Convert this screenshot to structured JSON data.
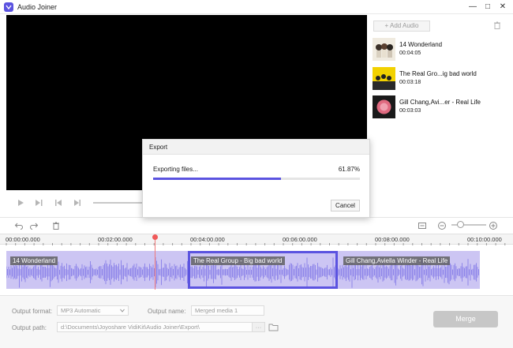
{
  "window": {
    "title": "Audio Joiner"
  },
  "sidebar": {
    "add_label": "+ Add Audio",
    "tracks": [
      {
        "name": "14 Wonderland",
        "duration": "00:04:05"
      },
      {
        "name": "The Real Gro...ig bad world",
        "duration": "00:03:18"
      },
      {
        "name": "Gill Chang,Avi...er - Real Life",
        "duration": "00:03:03"
      }
    ]
  },
  "export_dialog": {
    "title": "Export",
    "status": "Exporting files...",
    "percent_text": "61.87%",
    "progress": 0.6187,
    "cancel_label": "Cancel"
  },
  "ruler": {
    "ticks": [
      "00:00:00.000",
      "00:02:00.000",
      "00:04:00.000",
      "00:06:00.000",
      "00:08:00.000",
      "00:10:00.000"
    ]
  },
  "timeline": {
    "clips": [
      {
        "label": "14 Wonderland"
      },
      {
        "label": "The Real Group - Big bad world"
      },
      {
        "label": "Gill Chang,Aviella Winder - Real Life"
      }
    ]
  },
  "output": {
    "format_label": "Output format:",
    "format_value": "MP3 Automatic",
    "name_label": "Output name:",
    "name_value": "Merged media 1",
    "path_label": "Output path:",
    "path_value": "d:\\Documents\\Joyoshare VidiKit\\Audio Joiner\\Export\\",
    "path_more": "···",
    "merge_label": "Merge"
  },
  "colors": {
    "accent": "#5b53e0",
    "waveform": "#8f86ea",
    "timeline_bg": "#ccc5f3",
    "playhead": "#f05a5a"
  }
}
